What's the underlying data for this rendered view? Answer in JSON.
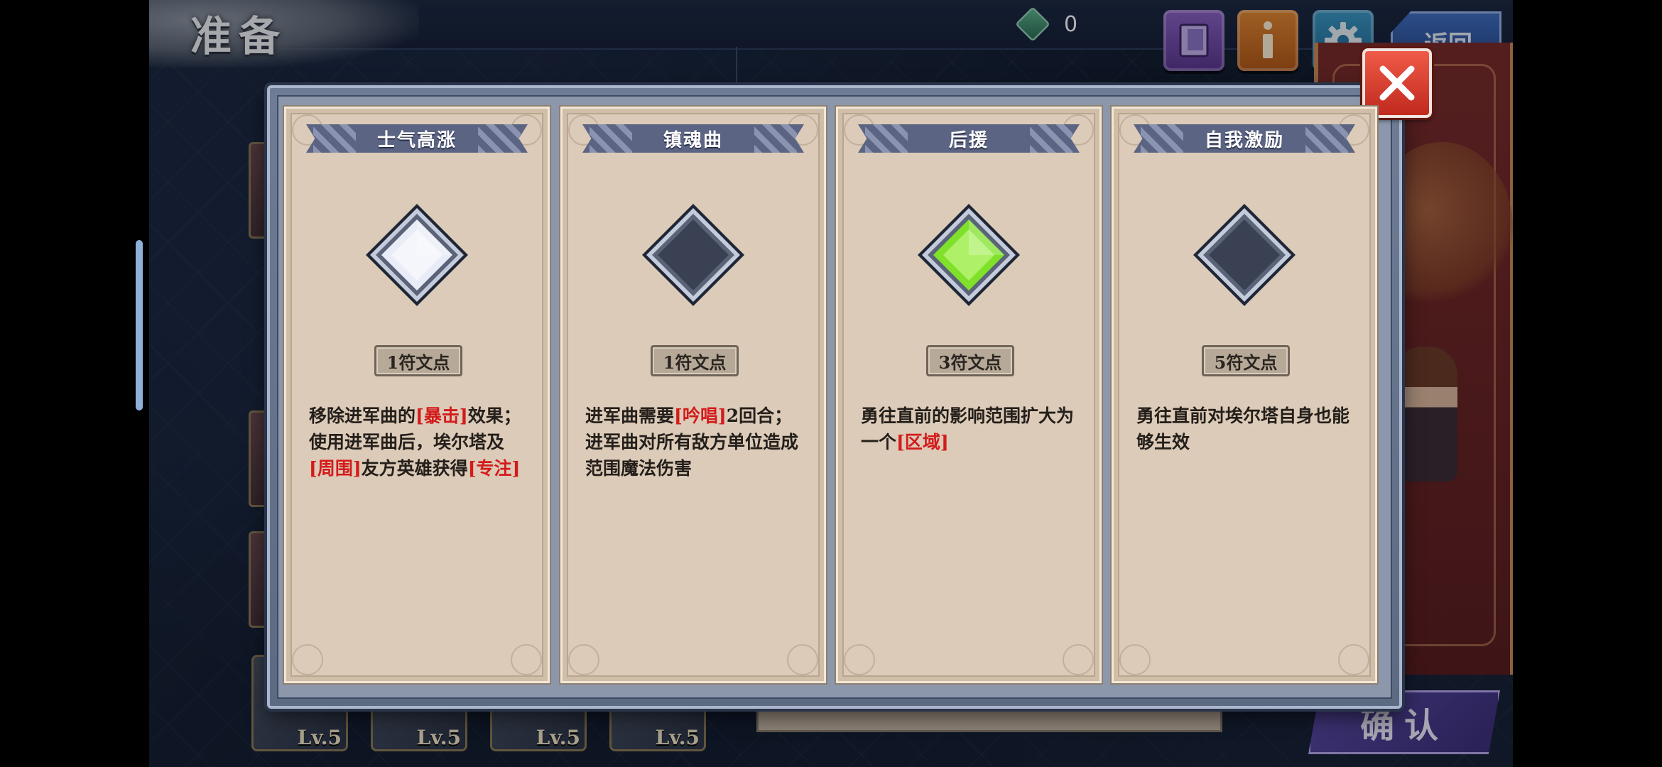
{
  "screen": {
    "title": "准备",
    "currency_value": "0",
    "back_label": "返回",
    "confirm_label": "确认"
  },
  "heroes": [
    {
      "level": "Lv.5"
    },
    {
      "level": "Lv.5"
    },
    {
      "level": "Lv.5"
    },
    {
      "level": "Lv.5"
    }
  ],
  "modal": {
    "cards": [
      {
        "title": "士气高涨",
        "cost": "1符文点",
        "rune_state": "white",
        "desc_parts": [
          {
            "text": "移除进军曲的",
            "hl": false
          },
          {
            "text": "[暴击]",
            "hl": true
          },
          {
            "text": "效果；使用进军曲后，埃尔塔及",
            "hl": false
          },
          {
            "text": "[周围]",
            "hl": true
          },
          {
            "text": "友方英雄获得",
            "hl": false
          },
          {
            "text": "[专注]",
            "hl": true
          }
        ]
      },
      {
        "title": "镇魂曲",
        "cost": "1符文点",
        "rune_state": "empty",
        "desc_parts": [
          {
            "text": "进军曲需要",
            "hl": false
          },
          {
            "text": "[吟唱]",
            "hl": true
          },
          {
            "text": "2回合；进军曲对所有敌方单位造成范围魔法伤害",
            "hl": false
          }
        ]
      },
      {
        "title": "后援",
        "cost": "3符文点",
        "rune_state": "green",
        "desc_parts": [
          {
            "text": "勇往直前的影响范围扩大为一个",
            "hl": false
          },
          {
            "text": "[区域]",
            "hl": true
          }
        ]
      },
      {
        "title": "自我激励",
        "cost": "5符文点",
        "rune_state": "empty",
        "desc_parts": [
          {
            "text": "勇往直前对埃尔塔自身也能够生效",
            "hl": false
          }
        ]
      }
    ]
  },
  "icons": {
    "close": "close-icon",
    "book": "book-icon",
    "info": "info-icon",
    "settings": "gear-icon",
    "currency": "rune-gem-icon"
  },
  "colors": {
    "highlight": "#d31b1b",
    "rune_white": "#e9ecf6",
    "rune_green": "#7fe12a",
    "rune_empty": "#3a4152"
  }
}
